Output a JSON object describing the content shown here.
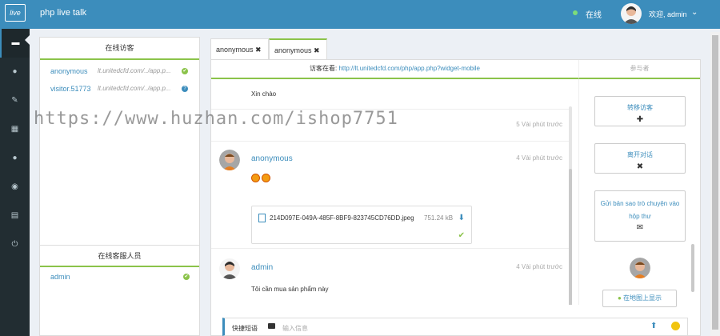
{
  "header": {
    "logo_text": "live",
    "app_title": "php live talk",
    "status_label": "在线",
    "welcome": "欢迎, admin"
  },
  "visitors_panel": {
    "title": "在线访客",
    "visitors": [
      {
        "name": "anonymous",
        "url": "lt.unitedcfd.com/../app.p..."
      },
      {
        "name": "visitor.51773",
        "url": "lt.unitedcfd.com/../app.p..."
      }
    ],
    "staff_title": "在线客服人员",
    "staff": [
      {
        "name": "admin"
      }
    ]
  },
  "tabs": [
    {
      "label": "anonymous",
      "close": "✖"
    },
    {
      "label": "anonymous",
      "close": "✖"
    }
  ],
  "chat": {
    "visitor_at_label": "访客在看:",
    "visitor_url": "http://lt.unitedcfd.com/php/app.php?widget-mobile",
    "participants_label": "参与者",
    "messages": [
      {
        "text": "Xin chào"
      },
      {
        "time": "5 Vài phút trước"
      },
      {
        "author": "anonymous",
        "time": "4 Vài phút trước"
      },
      {
        "file_name": "214D097E-049A-485F-8BF9-823745CD76DD.jpeg",
        "file_size": "751.24 kB"
      },
      {
        "author": "admin",
        "time": "4 Vài phút trước",
        "text": "Tôi cần mua sản phẩm này"
      }
    ]
  },
  "actions": {
    "transfer": "转移访客",
    "transfer_icon": "✚",
    "leave": "离开对话",
    "leave_icon": "✖",
    "send_copy": "Gửi bản sao trò chuyện vào hộp thư",
    "send_copy_icon": "✉",
    "map": "在地图上显示"
  },
  "input": {
    "quick_reply": "快捷短语",
    "placeholder": "输入信息"
  },
  "watermark": "https://www.huzhan.com/ishop7751",
  "colors": {
    "header": "#3c8dbc",
    "sidebar": "#222d32",
    "accent_green": "#8bc34a",
    "link_blue": "#3c8dbc"
  }
}
